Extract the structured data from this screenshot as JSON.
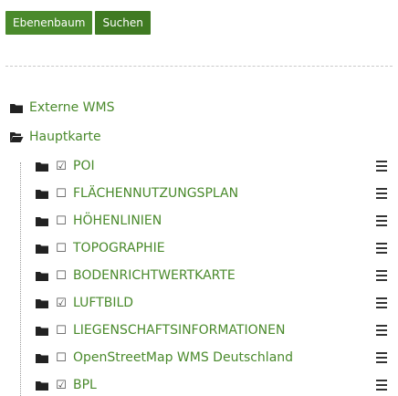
{
  "tabs": [
    {
      "label": "Ebenenbaum"
    },
    {
      "label": "Suchen"
    }
  ],
  "tree": {
    "groups": [
      {
        "label": "Externe WMS",
        "state": "closed"
      },
      {
        "label": "Hauptkarte",
        "state": "open"
      }
    ],
    "layers": [
      {
        "label": "POI",
        "checked": true,
        "check": "☑"
      },
      {
        "label": "FLÄCHENNUTZUNGSPLAN",
        "checked": false,
        "check": "☐"
      },
      {
        "label": "HÖHENLINIEN",
        "checked": false,
        "check": "☐"
      },
      {
        "label": "TOPOGRAPHIE",
        "checked": false,
        "check": "☐"
      },
      {
        "label": "BODENRICHTWERTKARTE",
        "checked": false,
        "check": "☐"
      },
      {
        "label": "LUFTBILD",
        "checked": true,
        "check": "☑"
      },
      {
        "label": "LIEGENSCHAFTSINFORMATIONEN",
        "checked": false,
        "check": "☐"
      },
      {
        "label": "OpenStreetMap WMS Deutschland",
        "checked": false,
        "check": "☐"
      },
      {
        "label": "BPL",
        "checked": true,
        "check": "☑"
      }
    ]
  },
  "colors": {
    "accent": "#4a8a2c",
    "icon": "#222222"
  },
  "icons": {
    "folder": "folder-icon",
    "folder_open": "folder-open-icon",
    "menu": "menu-icon"
  }
}
